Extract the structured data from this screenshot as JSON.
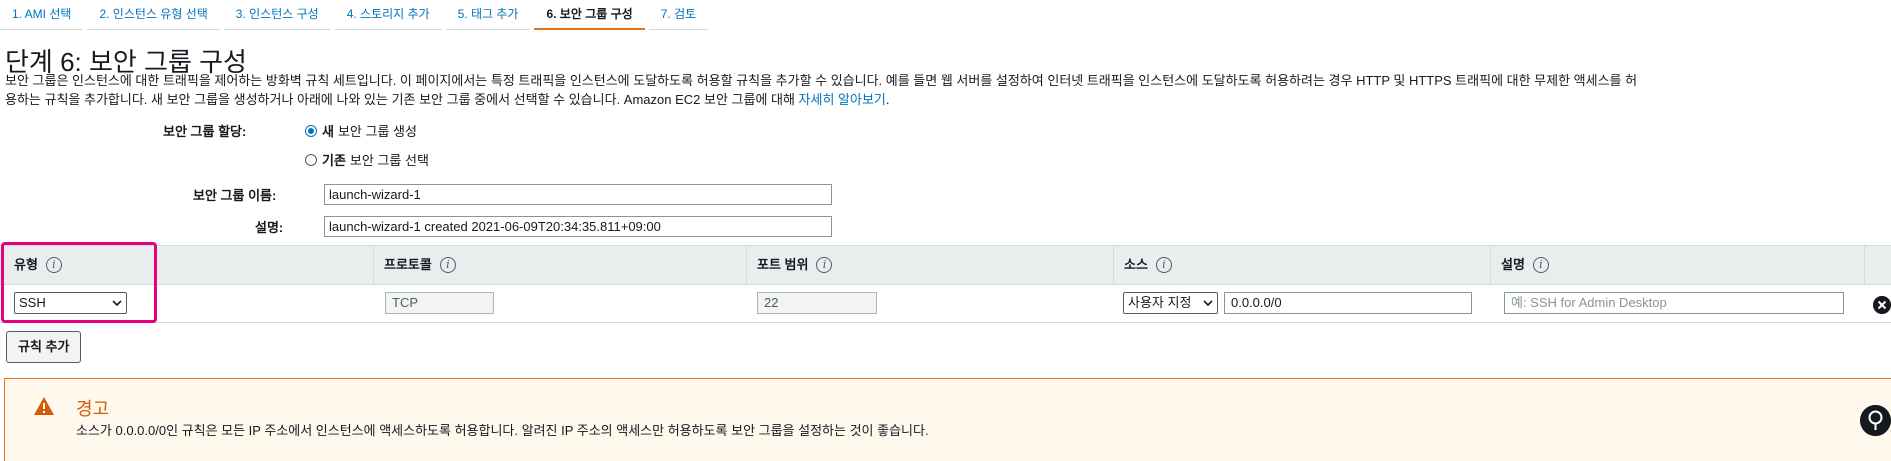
{
  "tabs": [
    {
      "label": "1. AMI 선택"
    },
    {
      "label": "2. 인스턴스 유형 선택"
    },
    {
      "label": "3. 인스턴스 구성"
    },
    {
      "label": "4. 스토리지 추가"
    },
    {
      "label": "5. 태그 추가"
    },
    {
      "label": "6. 보안 그룹 구성"
    },
    {
      "label": "7. 검토"
    }
  ],
  "page": {
    "title": "단계 6: 보안 그룹 구성",
    "intro_line1": "보안 그룹은 인스턴스에 대한 트래픽을 제어하는 방화벽 규칙 세트입니다. 이 페이지에서는 특정 트래픽을 인스턴스에 도달하도록 허용할 규칙을 추가할 수 있습니다. 예를 들면 웹 서버를 설정하여 인터넷 트래픽을 인스턴스에 도달하도록 허용하려는 경우 HTTP 및 HTTPS 트래픽에 대한 무제한 액세스를 허",
    "intro_line2": "용하는 규칙을 추가합니다. 새 보안 그룹을 생성하거나 아래에 나와 있는 기존 보안 그룹 중에서 선택할 수 있습니다. Amazon EC2 보안 그룹에 대해 ",
    "learn_more": "자세히 알아보기",
    "intro_end": "."
  },
  "form": {
    "assign_label": "보안 그룹 할당:",
    "option_new_bold": "새",
    "option_new_rest": "보안 그룹 생성",
    "option_existing_bold": "기존",
    "option_existing_rest": "보안 그룹 선택",
    "name_label": "보안 그룹 이름:",
    "name_value": "launch-wizard-1",
    "desc_label": "설명:",
    "desc_value": "launch-wizard-1 created 2021-06-09T20:34:35.811+09:00"
  },
  "rules": {
    "headers": [
      "유형",
      "프로토콜",
      "포트 범위",
      "소스",
      "설명"
    ],
    "row": {
      "type": "SSH",
      "protocol": "TCP",
      "port": "22",
      "source_select": "사용자 지정",
      "source_value": "0.0.0.0/0",
      "description_placeholder": "예: SSH for Admin Desktop"
    },
    "add_rule_label": "규칙 추가"
  },
  "warning": {
    "title": "경고",
    "text": "소스가 0.0.0.0/0인 규칙은 모든 IP 주소에서 인스턴스에 액세스하도록 허용합니다. 알려진 IP 주소의 액세스만 허용하도록 보안 그룹을 설정하는 것이 좋습니다."
  },
  "icons": {
    "info": "info-icon",
    "warning": "warning-icon",
    "remove": "remove-icon",
    "chevron": "chevron-down-icon",
    "feedback": "feedback-icon"
  },
  "colors": {
    "accent": "#0073bb",
    "active_tab": "#ec7211",
    "highlight": "#e6007e",
    "warning_title": "#d45b07",
    "warning_bg": "#fef8ed"
  }
}
